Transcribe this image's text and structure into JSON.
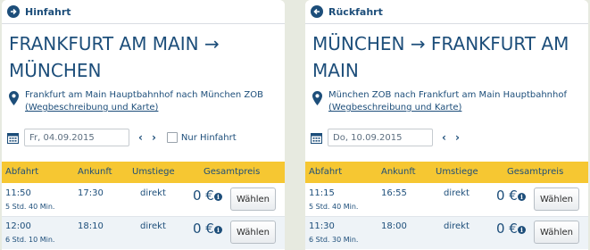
{
  "outbound": {
    "header": "Hinfahrt",
    "route_title": "FRANKFURT AM MAIN → MÜNCHEN",
    "station_text": "Frankfurt am Main Hauptbahnhof nach München ZOB",
    "directions_link": "(Wegbeschreibung und Karte)",
    "date_value": "Fr, 04.09.2015",
    "checkbox_label": "Nur Hinfahrt",
    "columns": {
      "departure": "Abfahrt",
      "arrival": "Ankunft",
      "changes": "Umstiege",
      "price": "Gesamtpreis"
    },
    "trips": [
      {
        "departure": "11:50",
        "duration": "5 Std. 40 Min.",
        "arrival": "17:30",
        "changes": "direkt",
        "price": "0 €",
        "button": "Wählen"
      },
      {
        "departure": "12:00",
        "duration": "6 Std. 10 Min.",
        "arrival": "18:10",
        "changes": "direkt",
        "price": "0 €",
        "button": "Wählen"
      }
    ]
  },
  "return": {
    "header": "Rückfahrt",
    "route_title": "MÜNCHEN → FRANKFURT AM MAIN",
    "station_text": "München ZOB nach Frankfurt am Main Hauptbahnhof",
    "directions_link": "(Wegbeschreibung und Karte)",
    "date_value": "Do, 10.09.2015",
    "columns": {
      "departure": "Abfahrt",
      "arrival": "Ankunft",
      "changes": "Umstiege",
      "price": "Gesamtpreis"
    },
    "trips": [
      {
        "departure": "11:15",
        "duration": "5 Std. 40 Min.",
        "arrival": "16:55",
        "changes": "direkt",
        "price": "0 €",
        "button": "Wählen"
      },
      {
        "departure": "11:30",
        "duration": "6 Std. 30 Min.",
        "arrival": "18:00",
        "changes": "direkt",
        "price": "0 €",
        "button": "Wählen"
      }
    ]
  },
  "icons": {
    "nav_prev": "‹",
    "nav_next": "›",
    "info": "i"
  },
  "colors": {
    "primary": "#1d4e7a",
    "table_header": "#f6c732",
    "page_background": "#e7eae0"
  }
}
